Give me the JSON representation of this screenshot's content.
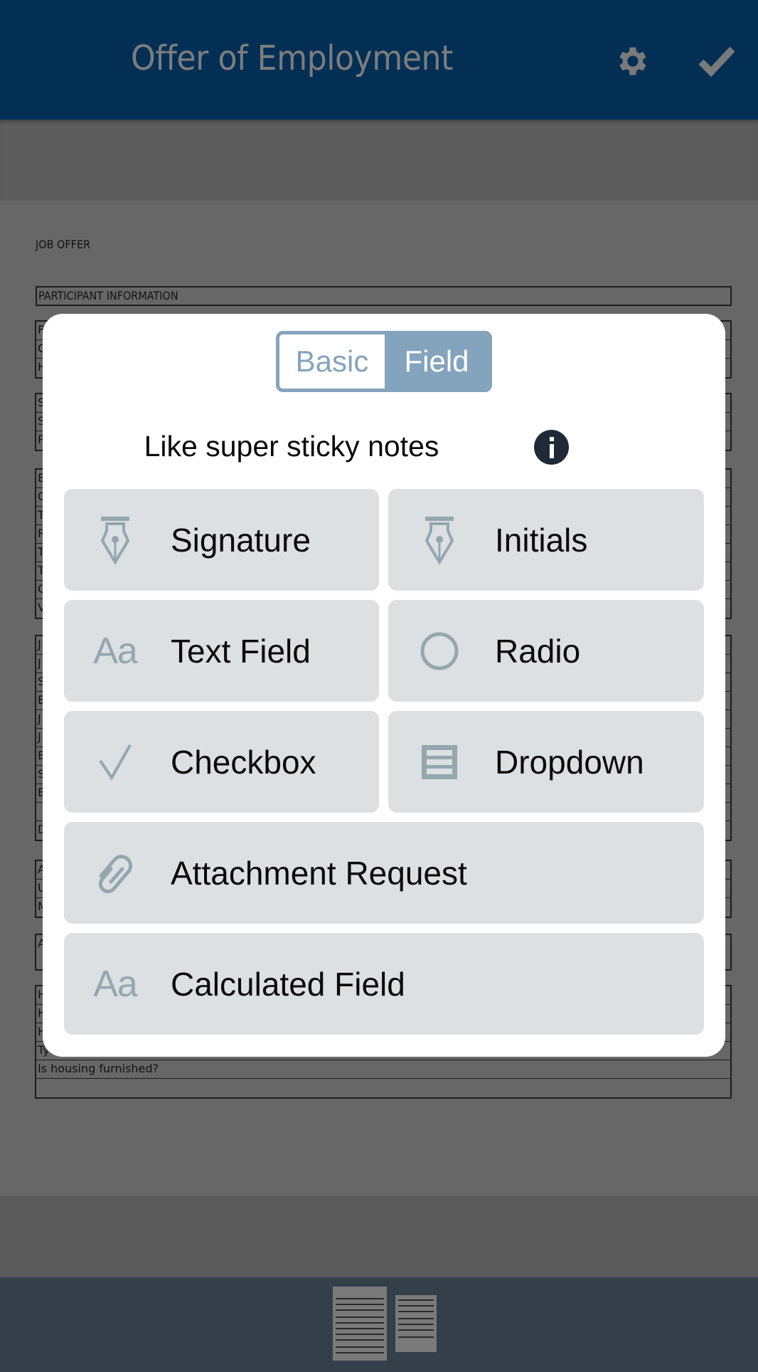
{
  "header": {
    "title": "Offer of Employment",
    "settings_icon": "gear-icon",
    "done_icon": "checkmark-icon"
  },
  "document": {
    "title": "JOB OFFER",
    "section_header": "PARTICIPANT INFORMATION",
    "table_groups": [
      [
        "F",
        "C",
        "H"
      ],
      [
        "S",
        "S",
        "P"
      ],
      [
        "E",
        "C",
        "T",
        "R",
        "T",
        "T",
        "C",
        "V"
      ],
      [
        "J",
        "J",
        "S",
        "E",
        "J",
        "J",
        "E",
        "S",
        "E",
        "",
        "D"
      ],
      [
        "A",
        "U",
        "M"
      ],
      [
        "A a"
      ],
      [
        "H",
        "H",
        "H",
        "Ty",
        "Is housing furnished?",
        ""
      ]
    ]
  },
  "modal": {
    "segmented_control": {
      "options": [
        "Basic",
        "Field"
      ],
      "selected": "Field"
    },
    "tagline": "Like super sticky notes",
    "info_icon": "info-icon",
    "field_types": [
      {
        "label": "Signature",
        "icon": "fountain-pen-icon"
      },
      {
        "label": "Initials",
        "icon": "fountain-pen-icon"
      },
      {
        "label": "Text Field",
        "icon": "text-aa-icon",
        "icon_text": "Aa"
      },
      {
        "label": "Radio",
        "icon": "radio-circle-icon"
      },
      {
        "label": "Checkbox",
        "icon": "checkmark-icon"
      },
      {
        "label": "Dropdown",
        "icon": "list-icon"
      },
      {
        "label": "Attachment Request",
        "icon": "paperclip-icon"
      },
      {
        "label": "Calculated Field",
        "icon": "text-aa-icon",
        "icon_text": "Aa"
      }
    ]
  },
  "thumbnails": {
    "pages": [
      "Page 1",
      "Page 2"
    ],
    "selected": 1
  },
  "colors": {
    "header_bg": "#032f55",
    "accent": "#84a3bd",
    "tile_bg": "#dce0e3",
    "icon_gray": "#94a7af",
    "thumb_bar_bg": "#343f49"
  }
}
